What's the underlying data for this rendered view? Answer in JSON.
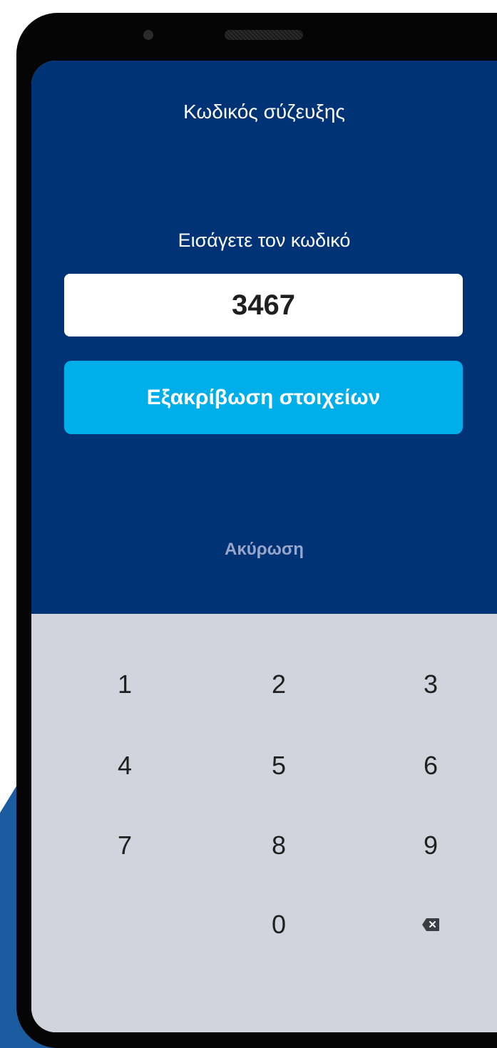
{
  "screen": {
    "title": "Κωδικός σύζευξης",
    "prompt": "Εισάγετε τον κωδικό",
    "code_value": "3467",
    "verify_button_label": "Εξακρίβωση στοιχείων",
    "cancel_label": "Ακύρωση"
  },
  "keypad": {
    "keys": [
      "1",
      "2",
      "3",
      "4",
      "5",
      "6",
      "7",
      "8",
      "9",
      "0"
    ],
    "backspace_icon": "backspace-icon"
  },
  "colors": {
    "header_background": "#003375",
    "button_accent": "#00aeea",
    "keypad_background": "#d1d4dc",
    "cancel_text": "#9aa6c9",
    "device_frame": "#050505",
    "decorative_blue": "#1b5ca0"
  }
}
